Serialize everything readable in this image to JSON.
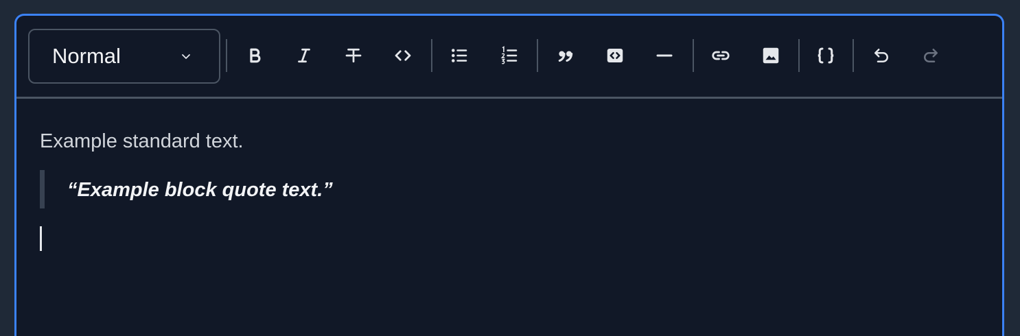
{
  "block_type_select": {
    "value": "Normal",
    "icon": "chevron-down-icon"
  },
  "toolbar": {
    "buttons": [
      {
        "name": "bold",
        "icon": "bold-icon",
        "state": "enabled"
      },
      {
        "name": "italic",
        "icon": "italic-icon",
        "state": "enabled"
      },
      {
        "name": "strikethrough",
        "icon": "strikethrough-icon",
        "state": "enabled"
      },
      {
        "name": "inline-code",
        "icon": "code-icon",
        "state": "enabled"
      },
      {
        "name": "bulleted-list",
        "icon": "bulleted-list-icon",
        "state": "enabled"
      },
      {
        "name": "numbered-list",
        "icon": "numbered-list-icon",
        "state": "enabled"
      },
      {
        "name": "block-quote",
        "icon": "quote-icon",
        "state": "enabled"
      },
      {
        "name": "code-block",
        "icon": "code-block-icon",
        "state": "enabled"
      },
      {
        "name": "horizontal-rule",
        "icon": "horizontal-rule-icon",
        "state": "enabled"
      },
      {
        "name": "link",
        "icon": "link-icon",
        "state": "enabled"
      },
      {
        "name": "image",
        "icon": "image-icon",
        "state": "enabled"
      },
      {
        "name": "source",
        "icon": "braces-icon",
        "state": "enabled"
      },
      {
        "name": "undo",
        "icon": "undo-icon",
        "state": "enabled"
      },
      {
        "name": "redo",
        "icon": "redo-icon",
        "state": "disabled"
      }
    ]
  },
  "content": {
    "paragraph": "Example standard text.",
    "blockquote": "“Example block quote text.”"
  },
  "colors": {
    "page_background": "#1f2937",
    "editor_background": "#111827",
    "focus_border": "#3b82f6",
    "divider": "#4b5563",
    "icon": "#e5e7eb",
    "icon_disabled": "#6b7280",
    "text": "#d1d5db",
    "quote_bar": "#374151"
  }
}
